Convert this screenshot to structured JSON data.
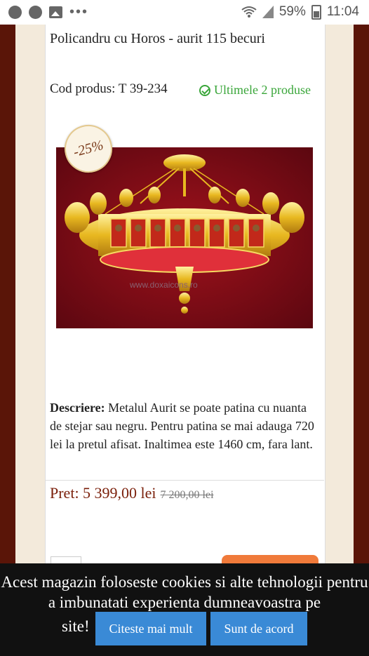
{
  "status_bar": {
    "battery": "59%",
    "time": "11:04",
    "dots": "•••"
  },
  "product": {
    "title": "Policandru cu Horos - aurit 115 becuri",
    "code": "Cod produs: T 39-234",
    "stock": "Ultimele 2 produse",
    "discount_badge": "-25%",
    "image_watermark": "www.doxaicons.ro",
    "description_label": "Descriere:",
    "description_text": " Metalul Aurit se poate patina cu nuanta de stejar sau negru. Pentru patina se mai adauga 720 lei la pretul afisat. Inaltimea este 1460 cm, fara lant.",
    "price_label": "Pret: 5 399,00 lei",
    "old_price": "7 200,00 lei"
  },
  "cookie_bar": {
    "text": "Acest magazin foloseste cookies si alte tehnologii pentru a imbunatati experienta dumneavoastra pe",
    "text_end": "site!",
    "more_button": "Citeste mai mult",
    "agree_button": "Sunt de acord"
  },
  "colors": {
    "accent_green": "#3aa63a",
    "price_red": "#7a1f0a",
    "button_blue": "#3a8ad6",
    "page_maroon": "#5a1508"
  }
}
